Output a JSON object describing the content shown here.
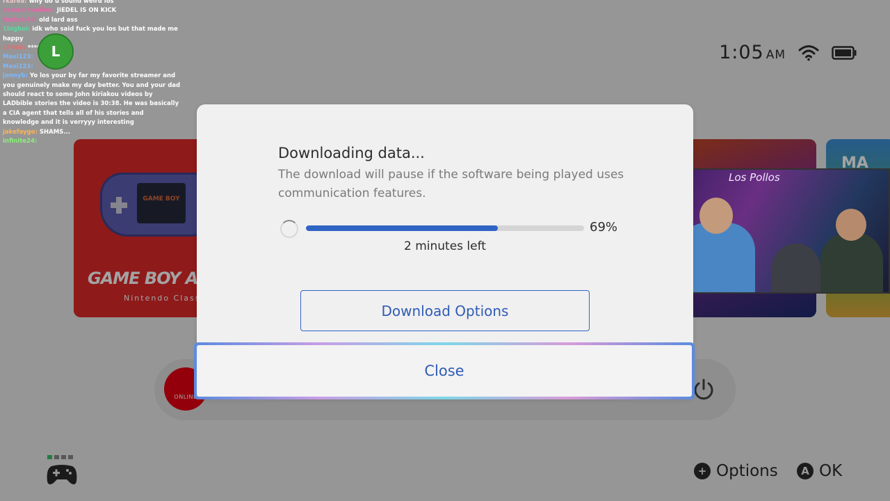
{
  "status": {
    "time": "1:05",
    "ampm": "AM",
    "wifi_icon": "wifi-icon",
    "battery_icon": "battery-icon"
  },
  "tiles": {
    "gba": {
      "screen_text": "GAME BOY",
      "logo": "GAME BOY ADVA",
      "subtitle": "Nintendo Classics"
    },
    "game2_label": "MA"
  },
  "webcam": {
    "neon_sign": "Los Pollos"
  },
  "dock": {
    "online_label": "ONLINE",
    "power_icon": "power-icon"
  },
  "chat": [
    {
      "user": "rkarea",
      "message": "why do u sound weird los",
      "color": "#e8c8c8"
    },
    {
      "user": "nemesiswalker",
      "message": "JIEDEL IS ON KICK",
      "color": "#e06aa6"
    },
    {
      "user": "timbob44",
      "message": "old lard ass",
      "color": "#e06aa6"
    },
    {
      "user": "1bigboi",
      "message": "idk who said fuck you los but that made me happy",
      "color": "#5fd6a0"
    },
    {
      "user": "LP666",
      "message": "******",
      "color": "#e07070"
    },
    {
      "user": "Maxi123",
      "message": "",
      "color": "#7db8ff"
    },
    {
      "user": "Maxi123",
      "message": "",
      "color": "#7db8ff"
    },
    {
      "user": "jonnyb",
      "message": "Yo los your by far my favorite streamer and you genuinely make my day better. You and your dad should react to some John kiriakou videos by LADbible stories the video is 30:38. He was basically a CIA agent that tells all of his stories and knowledge and it is verryyy interesting",
      "color": "#7db8ff"
    },
    {
      "user": "jakefaygo",
      "message": "SHAMS...",
      "color": "#ffb454"
    },
    {
      "user": "infinite24",
      "message": "",
      "color": "#8bef7a"
    }
  ],
  "modal": {
    "title": "Downloading data...",
    "description": "The download will pause if the software being played uses communication features.",
    "progress_percent": 69,
    "progress_label": "69%",
    "time_left": "2 minutes left",
    "options_button": "Download Options",
    "close_button": "Close"
  },
  "footer": {
    "options_icon": "plus-icon",
    "options_label": "Options",
    "ok_icon": "a-button-icon",
    "ok_glyph": "A",
    "ok_label": "OK",
    "controller_icon": "controller-icon"
  },
  "colors": {
    "accent": "#2f64c5",
    "online_red": "#e60012",
    "gba_red": "#e02a2a"
  }
}
